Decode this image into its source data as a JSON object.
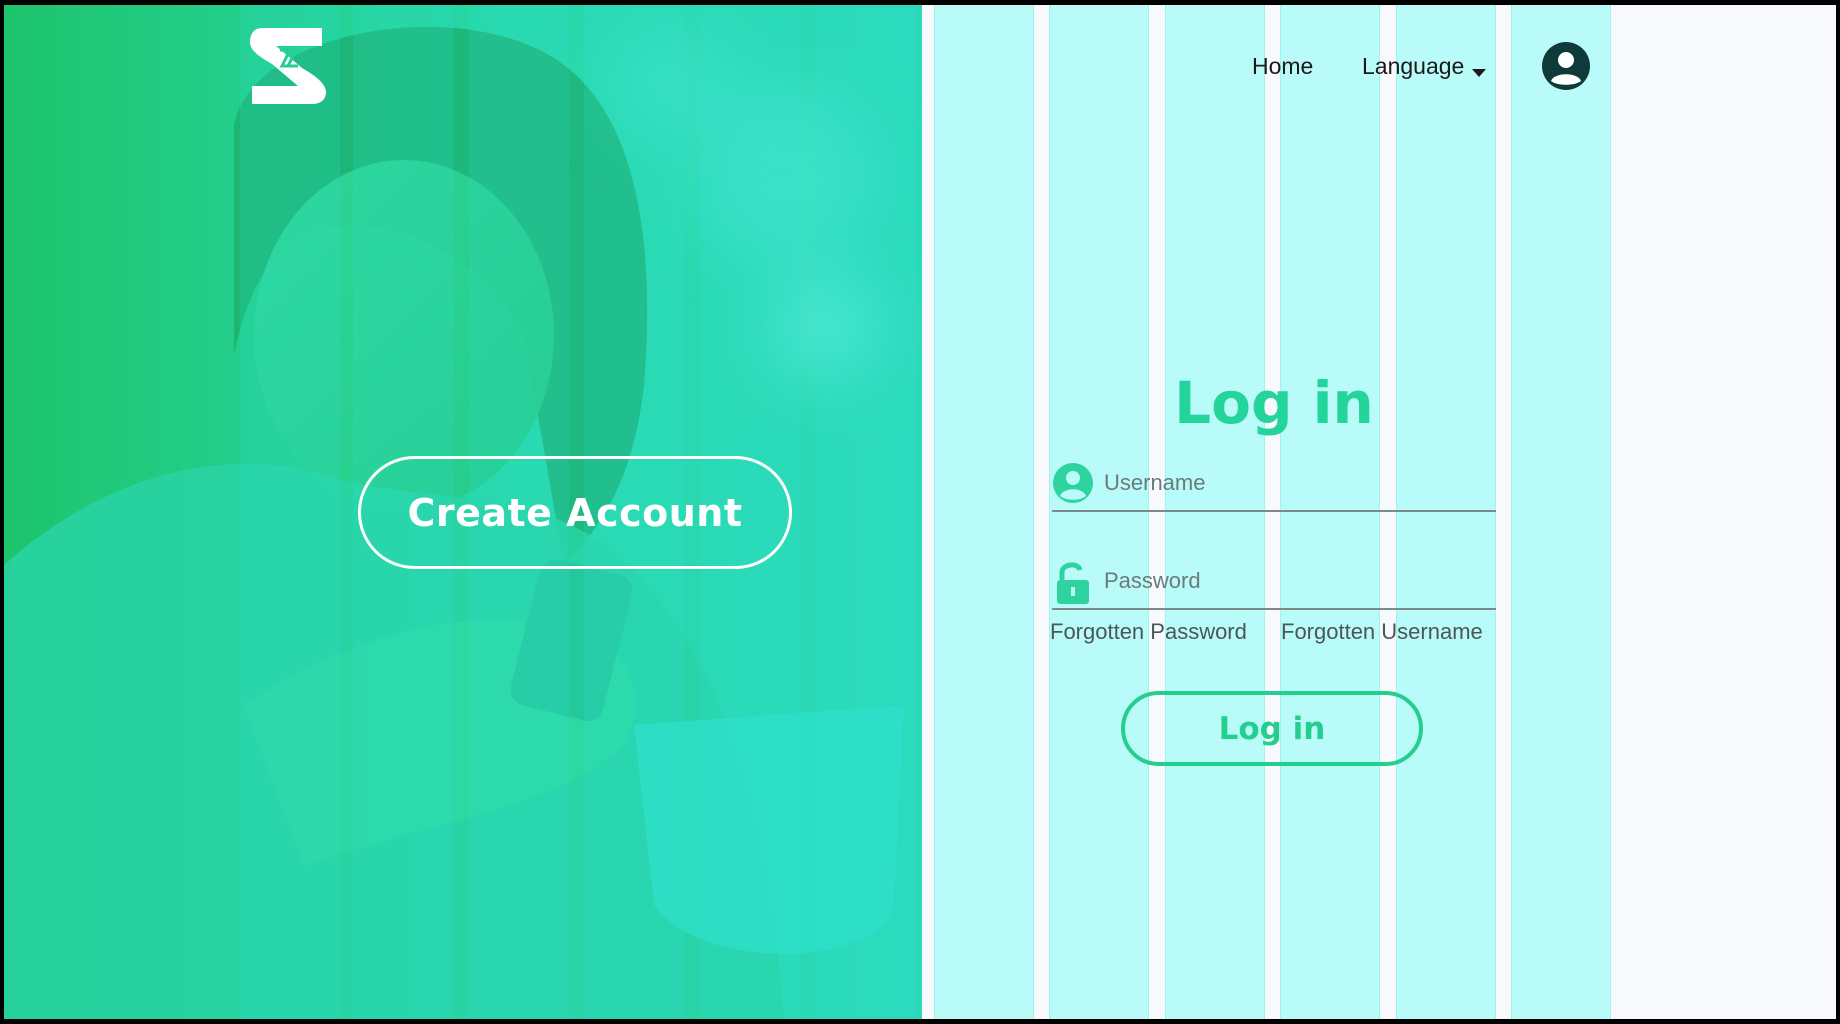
{
  "nav": {
    "home_label": "Home",
    "language_label": "Language"
  },
  "hero": {
    "create_account_label": "Create Account"
  },
  "login": {
    "title": "Log in",
    "username_placeholder": "Username",
    "password_placeholder": "Password",
    "forgotten_password": "Forgotten Password",
    "forgotten_username": "Forgotten Username",
    "submit_label": "Log in"
  },
  "icons": {
    "logo": "brand-s-logo",
    "account": "user-circle-icon",
    "username": "user-icon",
    "password": "unlocked-padlock-icon",
    "language_caret": "caret-down-icon"
  },
  "colors": {
    "accent": "#23d49b",
    "hero_green": "#1ec46c",
    "hero_teal": "#2bd9b8",
    "grid_column": "#b9fbf8",
    "dark": "#0f3a3a"
  }
}
